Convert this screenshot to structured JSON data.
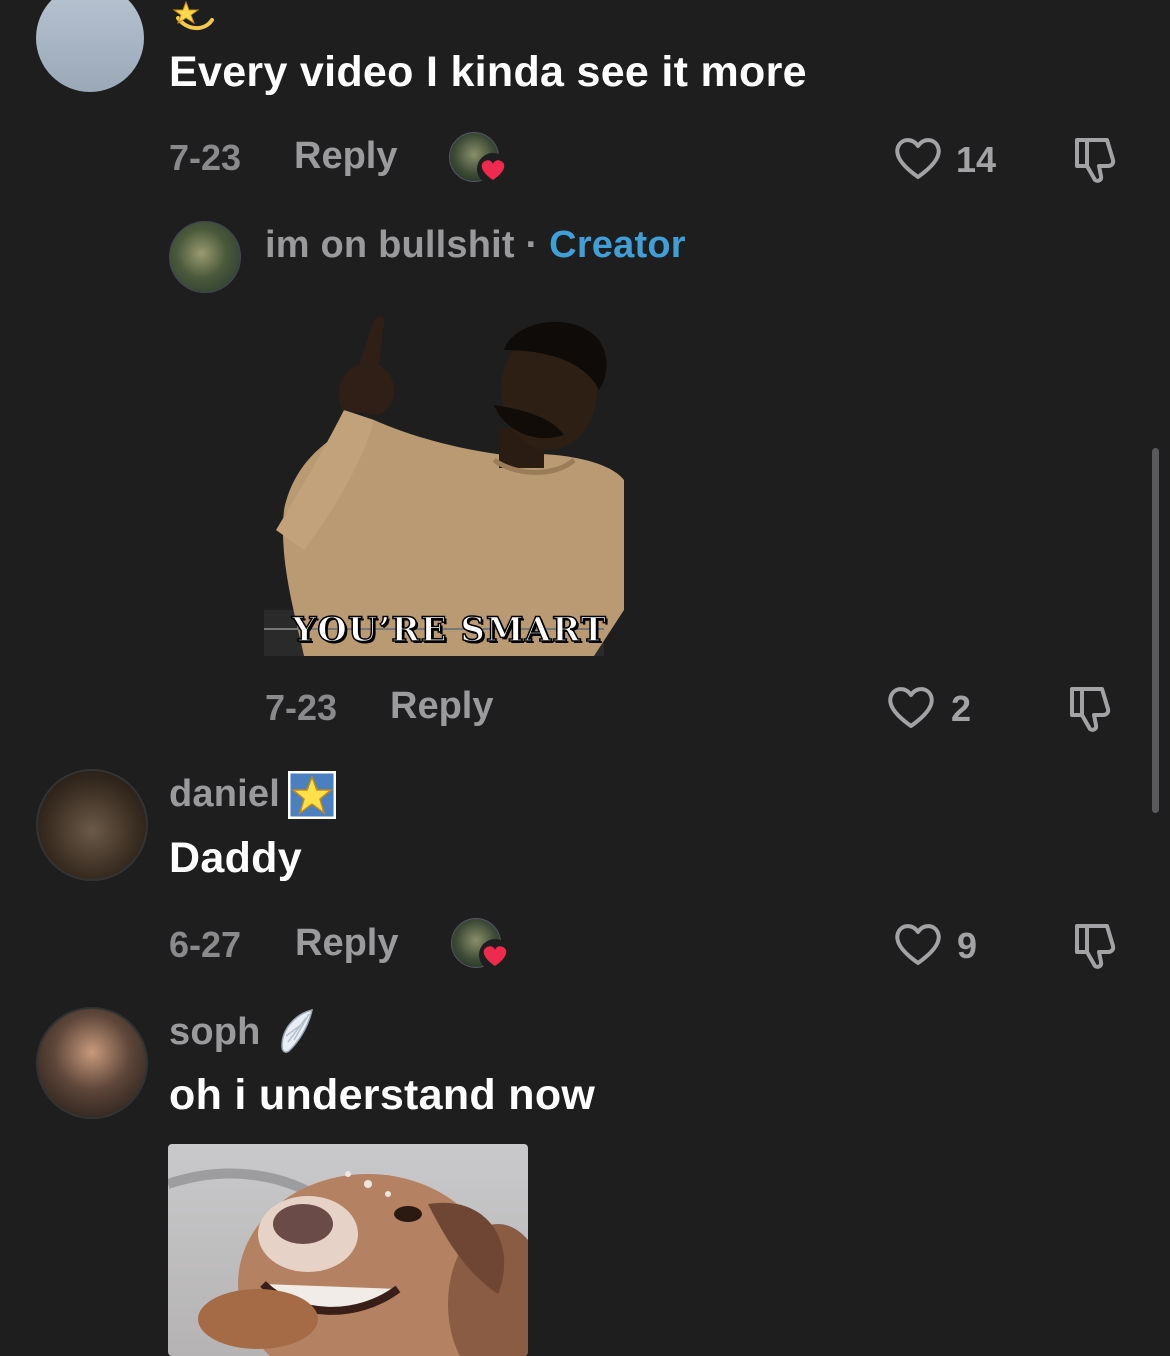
{
  "comments": [
    {
      "text": "Every video I kinda see it more",
      "date": "7-23",
      "reply_label": "Reply",
      "likes": "14",
      "reply": {
        "username": "im on bullshit",
        "separator": " · ",
        "badge": "Creator",
        "sticker_caption": "YOU’RE SMART",
        "date": "7-23",
        "reply_label": "Reply",
        "likes": "2"
      }
    },
    {
      "username": "daniel",
      "text": "Daddy",
      "date": "6-27",
      "reply_label": "Reply",
      "likes": "9"
    },
    {
      "username": "soph",
      "text": "oh i understand now"
    }
  ],
  "colors": {
    "background": "#1e1e1f",
    "creator_badge": "#3f9fd6",
    "liked_heart": "#f0294f"
  },
  "icons": [
    "shooting-star-emoji",
    "heart-outline-icon",
    "dislike-icon",
    "creator-liked-badge",
    "star-emoji",
    "angel-wing-emoji"
  ]
}
